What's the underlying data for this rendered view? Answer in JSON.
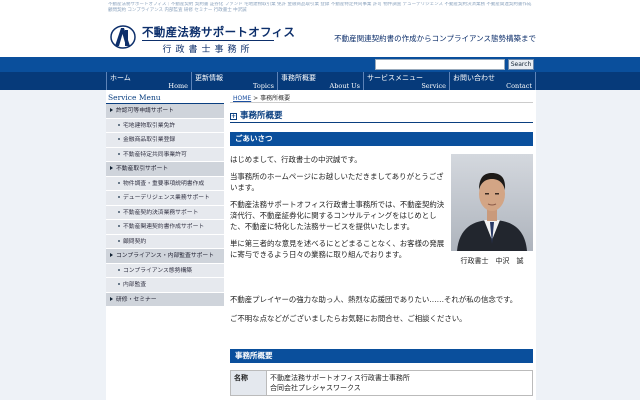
{
  "header": {
    "tiny_text": "不動産法務サポートオフィス｜不動産契約 契約書 証券化 ファンド 宅地建物取引業 免許 金融商品取引業 登録 不動産特定共同事業 許可 物件調査 デューデリジェンス 不動産契約決済業務 不動産関連契約書作成 顧問契約 コンプライアンス 内部監査 研修 セミナー 行政書士 中沢誠",
    "logo_title": "不動産法務サポートオフィス",
    "logo_sub": "行政書士事務所",
    "tagline": "不動産関連契約書の作成からコンプライアンス態勢構築まで",
    "search_placeholder": "",
    "search_button": "Search"
  },
  "nav": [
    {
      "jp": "ホーム",
      "en": "Home"
    },
    {
      "jp": "更新情報",
      "en": "Topics"
    },
    {
      "jp": "事務所概要",
      "en": "About Us"
    },
    {
      "jp": "サービスメニュー",
      "en": "Service"
    },
    {
      "jp": "お問い合わせ",
      "en": "Contact"
    }
  ],
  "sidebar": {
    "title": "Service Menu",
    "items": [
      {
        "label": "許認可等申請サポート",
        "level": "top"
      },
      {
        "label": "宅地建物取引業免許",
        "level": "sub"
      },
      {
        "label": "金融商品取引業登録",
        "level": "sub"
      },
      {
        "label": "不動産特定共同事業許可",
        "level": "sub"
      },
      {
        "label": "不動産取引サポート",
        "level": "top"
      },
      {
        "label": "物件調査・重要事項説明書作成",
        "level": "sub"
      },
      {
        "label": "デューデリジェンス業務サポート",
        "level": "sub"
      },
      {
        "label": "不動産契約決済業務サポート",
        "level": "sub"
      },
      {
        "label": "不動産関連契約書作成サポート",
        "level": "sub"
      },
      {
        "label": "顧問契約",
        "level": "sub"
      },
      {
        "label": "コンプライアンス・内部監査サポート",
        "level": "top"
      },
      {
        "label": "コンプライアンス態勢構築",
        "level": "sub"
      },
      {
        "label": "内部監査",
        "level": "sub"
      },
      {
        "label": "研修・セミナー",
        "level": "top"
      }
    ]
  },
  "breadcrumb": {
    "home": "HOME",
    "sep": ">",
    "current": "事務所概要"
  },
  "main": {
    "page_title": "事務所概要",
    "greeting_heading": "ごあいさつ",
    "paragraphs": [
      "はじめまして、行政書士の中沢誠です。",
      "当事務所のホームページにお越しいただきましてありがとうございます。",
      "不動産法務サポートオフィス行政書士事務所では、不動産契約決済代行、不動産証券化に関するコンサルティングをはじめとした、不動産に特化した法務サービスを提供いたします。",
      "単に第三者的な意見を述べるにとどまることなく、お客様の発展に寄与できるよう日々の業務に取り組んでおります。"
    ],
    "wide_paragraphs": [
      "不動産プレイヤーの強力な助っ人、熱烈な応援団でありたい……それが私の信念です。",
      "ご不明な点などがございましたらお気軽にお問合せ、ご相談ください。"
    ],
    "photo_caption": "行政書士　中沢　誠",
    "overview_heading": "事務所概要",
    "table": [
      {
        "label": "名称",
        "value_lines": [
          "不動産法務サポートオフィス行政書士事務所",
          "合同会社プレシャスワークス"
        ]
      }
    ]
  }
}
